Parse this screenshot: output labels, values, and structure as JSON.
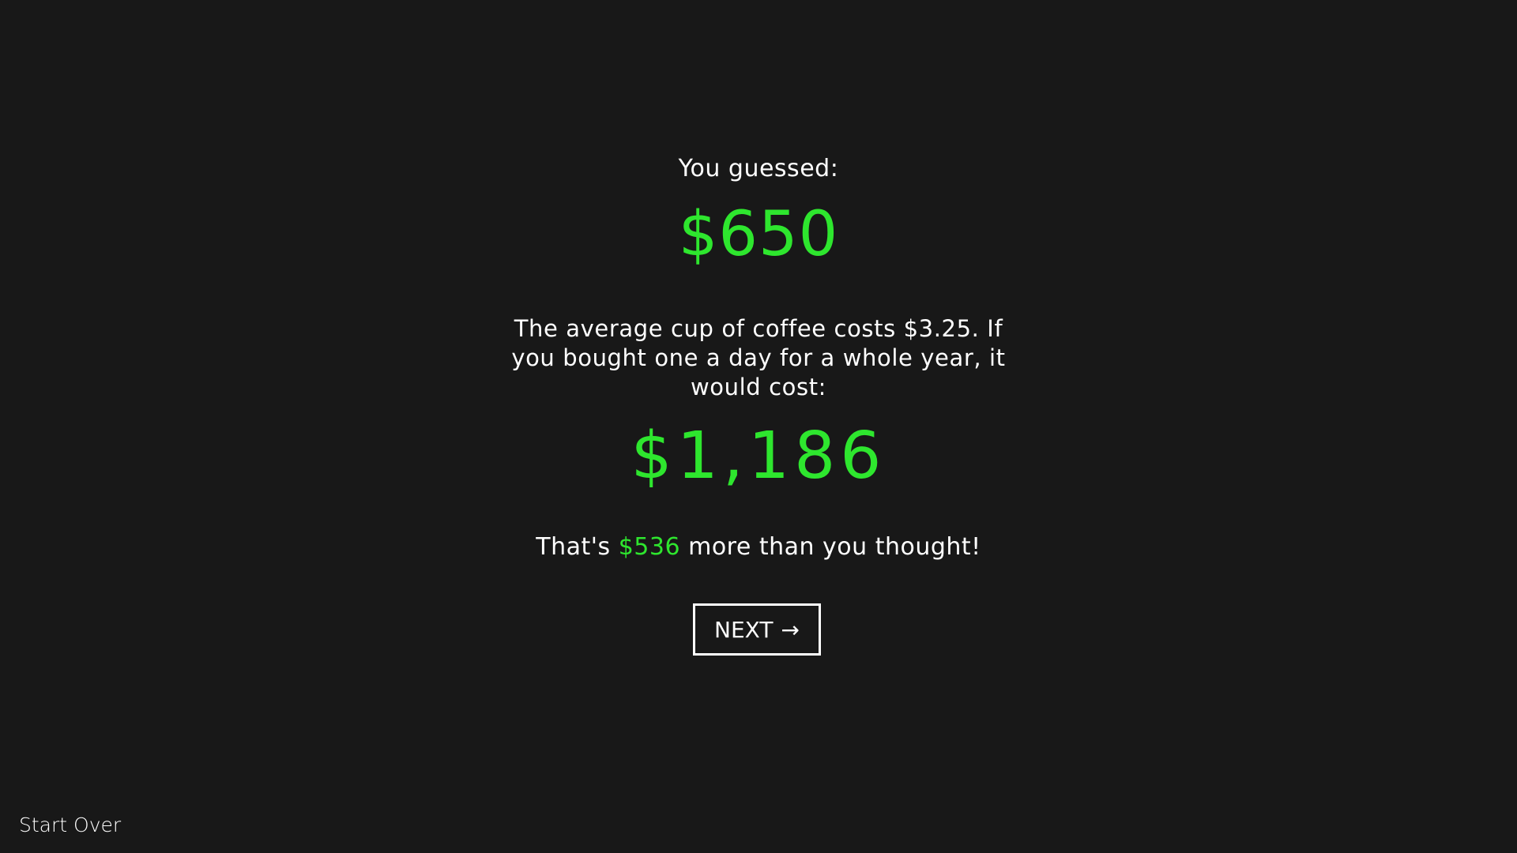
{
  "result": {
    "guess_label": "You guessed:",
    "guess_value": "$650",
    "explanation": "The average cup of coffee costs $3.25. If you bought one a day for a whole year, it would cost:",
    "actual_value": "$1,186",
    "difference_prefix": "That's ",
    "difference_amount": "$536",
    "difference_suffix": " more than you thought!"
  },
  "navigation": {
    "next_label": "NEXT",
    "next_icon": "arrow-right-icon",
    "start_over_label": "Start Over"
  },
  "colors": {
    "background": "#181818",
    "accent": "#2ee62e",
    "text": "#ffffff"
  }
}
